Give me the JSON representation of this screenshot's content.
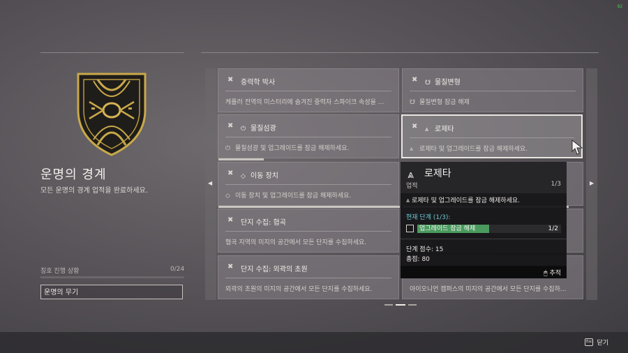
{
  "hud": {
    "fps": "82"
  },
  "seal": {
    "title": "운명의 경계",
    "description": "모든 운명의 경계 업적을 완료하세요.",
    "progress_label": "칭호 진행 상황",
    "progress_count": "0/24",
    "progress_fraction": 0.0,
    "title_reward": "운명의 무기"
  },
  "icons": {
    "card": "x-crossed-icon",
    "left": "arrow-left-icon",
    "right": "arrow-right-icon"
  },
  "cards": [
    {
      "title": "중력학 박사",
      "icon": "",
      "description": "케플러 전역의 미스터리에 숨겨진 중력자 스파이크 속성을 ..."
    },
    {
      "title": "물질변형",
      "icon": "☋",
      "description": "물질변형 잠금 해제"
    },
    {
      "title": "물질섬광",
      "icon": "⏻",
      "description": "물질섬광 및 업그레이드를 잠금 해제하세요."
    },
    {
      "title": "로제타",
      "icon": "⩓",
      "description": "로제타 및 업그레이드를 잠금 해제하세요."
    },
    {
      "title": "이동 장치",
      "icon": "◇",
      "description": "이동 장치 및 업그레이드를 잠금 해제하세요."
    },
    {
      "title": "",
      "icon": "",
      "description": ""
    },
    {
      "title": "단지 수집: 협곡",
      "icon": "",
      "description": "협곡 지역의 미지의 공간에서 모든 단지를 수집하세요."
    },
    {
      "title": "",
      "icon": "",
      "description": ""
    },
    {
      "title": "단지 수집: 외곽의 초원",
      "icon": "",
      "description": "외곽의 초원의 미지의 공간에서 모든 단지를 수집하세요."
    },
    {
      "title": "",
      "icon": "",
      "description": "아이오니언 캠퍼스의 미지의 공간에서 모든 단지를 수집하..."
    }
  ],
  "tooltip": {
    "icon": "⩓",
    "title": "로제타",
    "type": "업적",
    "count": "1/3",
    "description": "로제타 및 업그레이드를 잠금 해제하세요.",
    "stage": "현재 단계 (1/3):",
    "objective": "업그레이드 잠금 해제",
    "objective_progress": "1/2",
    "objective_fraction": 0.5,
    "score": "단계 점수: 15",
    "total": "총점: 80",
    "track": "추적"
  },
  "footer": {
    "close": "닫기",
    "key": "Esc"
  }
}
